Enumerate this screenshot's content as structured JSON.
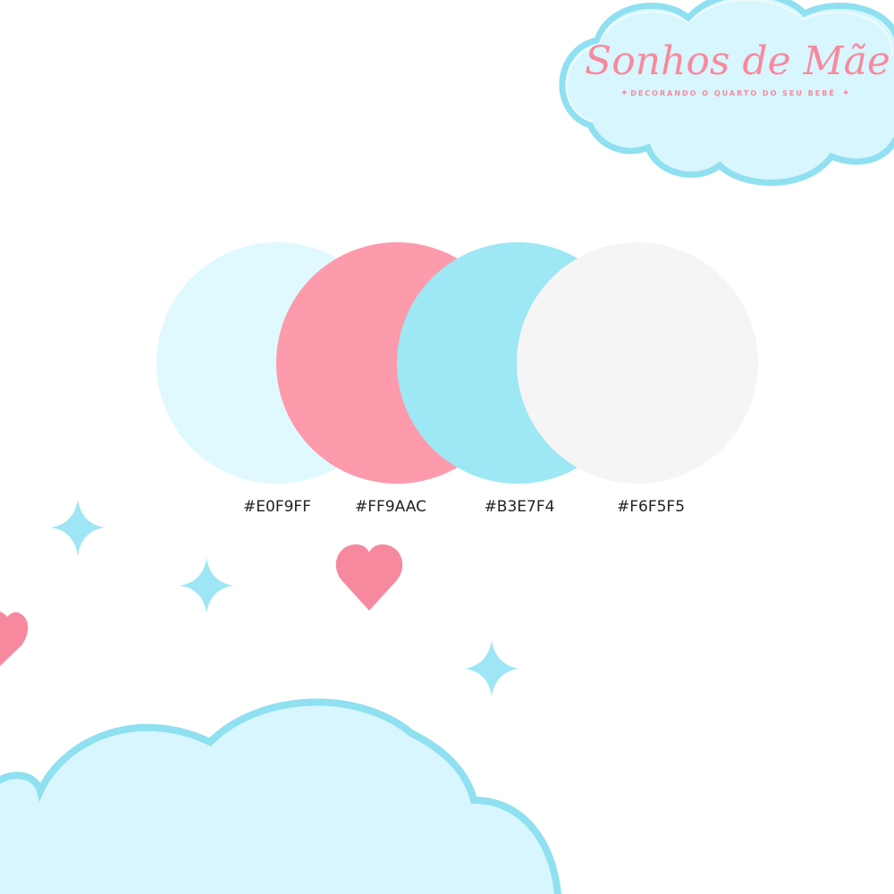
{
  "logo": {
    "title": "Sonhos de Mãe",
    "tagline": "DECORANDO O QUARTO DO SEU BEBÊ",
    "sparkle": "✦"
  },
  "palette": {
    "swatches": [
      {
        "label": "#E0F9FF",
        "color": "#E0F9FF"
      },
      {
        "label": "#FF9AAC",
        "color": "#FF9AAC"
      },
      {
        "label": "#B3E7F4",
        "color": "#B3E7F4"
      },
      {
        "label": "#F6F5F5",
        "color": "#F6F5F5"
      }
    ]
  },
  "colors": {
    "cloud_fill": "#d7f6fd",
    "cloud_outline": "#8fe0f0",
    "heart": "#f7899f",
    "sparkle": "#9ee6f5",
    "swatch_dark_1": "#fd9aac",
    "swatch_dark_2": "#9de8f4"
  },
  "decorations": {
    "icons": [
      "cloud-icon",
      "heart-icon",
      "sparkle-icon"
    ]
  }
}
